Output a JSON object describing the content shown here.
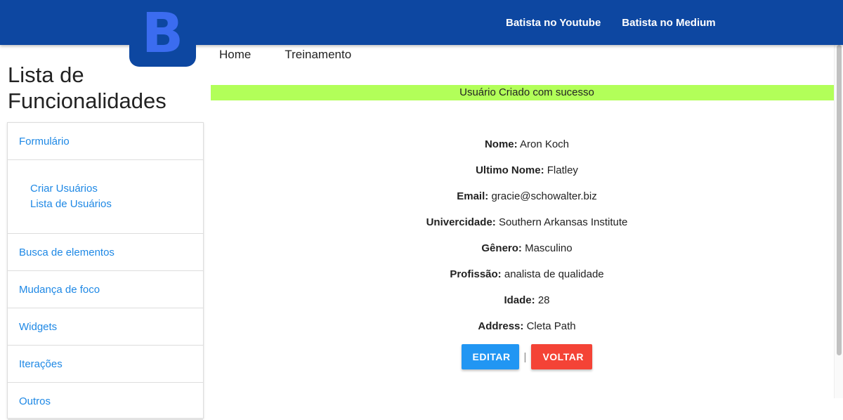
{
  "header": {
    "logo_letter": "B",
    "links": [
      "Batista no Youtube",
      "Batista no Medium"
    ]
  },
  "page_title": "Lista de Funcionalidades",
  "nav": [
    "Home",
    "Treinamento"
  ],
  "success_message": "Usuário Criado com sucesso",
  "sidebar": {
    "items": [
      {
        "label": "Formulário"
      },
      {
        "sub": [
          "Criar Usuários",
          "Lista de Usuários"
        ]
      },
      {
        "label": "Busca de elementos"
      },
      {
        "label": "Mudança de foco"
      },
      {
        "label": "Widgets"
      },
      {
        "label": "Iterações"
      },
      {
        "label": "Outros"
      }
    ]
  },
  "user": {
    "fields": [
      {
        "label": "Nome:",
        "value": "Aron Koch"
      },
      {
        "label": "Ultimo Nome:",
        "value": "Flatley"
      },
      {
        "label": "Email:",
        "value": "gracie@schowalter.biz"
      },
      {
        "label": "Univercidade:",
        "value": "Southern Arkansas Institute"
      },
      {
        "label": "Gênero:",
        "value": "Masculino"
      },
      {
        "label": "Profissão:",
        "value": "analista de qualidade"
      },
      {
        "label": "Idade:",
        "value": "28"
      },
      {
        "label": "Address:",
        "value": "Cleta Path"
      }
    ]
  },
  "actions": {
    "edit": "EDITAR",
    "separator": "|",
    "back": "VOLTAR"
  },
  "colors": {
    "header_bg": "#0d47a1",
    "success_bg": "#b2ff59",
    "link": "#1e88e5",
    "edit": "#2196f3",
    "back": "#f44336"
  }
}
